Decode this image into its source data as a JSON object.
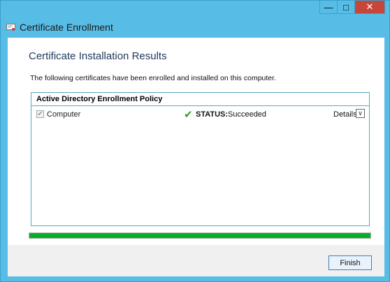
{
  "window": {
    "title": "Certificate Enrollment",
    "minimize_icon": "minimize-icon",
    "maximize_icon": "maximize-icon",
    "close_icon": "close-icon",
    "minimize_glyph": "—",
    "maximize_glyph": "□",
    "close_glyph": "✕"
  },
  "page": {
    "heading": "Certificate Installation Results",
    "intro": "The following certificates have been enrolled and installed on this computer."
  },
  "policy": {
    "name": "Active Directory Enrollment Policy",
    "certificates": [
      {
        "name": "Computer",
        "checked": true,
        "status_label": "STATUS:",
        "status_value": "Succeeded",
        "status_icon": "checkmark-icon",
        "details_label": "Details",
        "details_icon": "chevron-down-icon"
      }
    ]
  },
  "progress": {
    "value": 1.0,
    "color": "#06b025"
  },
  "buttons": {
    "finish_label": "Finish"
  },
  "glyphs": {
    "check": "✔",
    "status_check": "✔",
    "chevron": "∨"
  }
}
